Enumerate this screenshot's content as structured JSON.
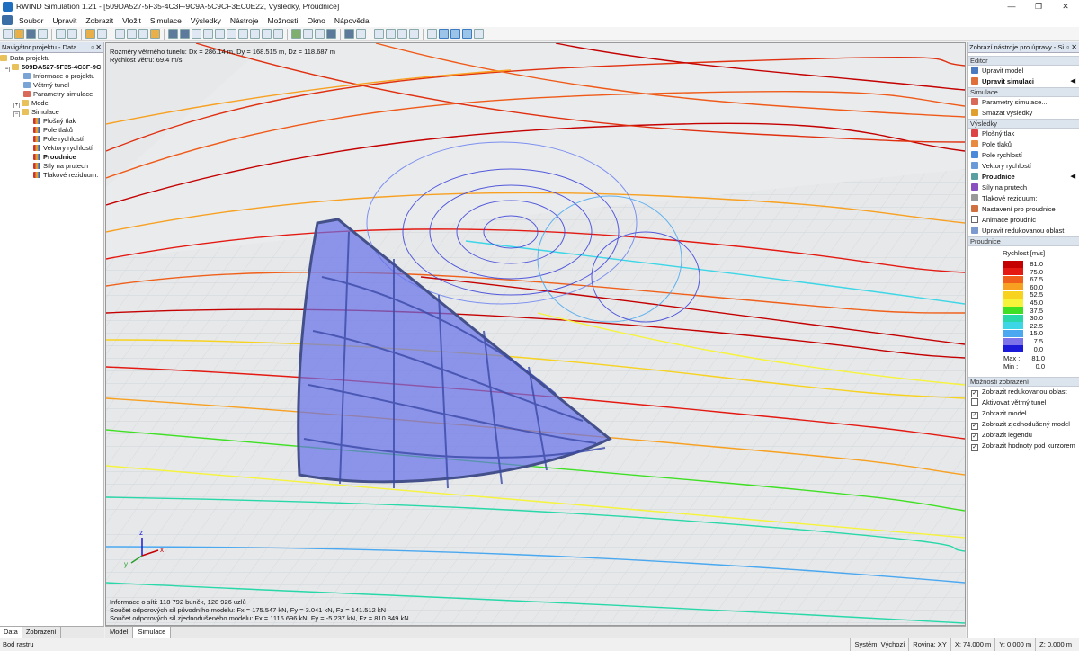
{
  "title": "RWIND Simulation 1.21 - [509DA527-5F35-4C3F-9C9A-5C9CF3EC0E22, Výsledky, Proudnice]",
  "window_buttons": [
    "—",
    "❐",
    "✕"
  ],
  "menu": [
    "Soubor",
    "Upravit",
    "Zobrazit",
    "Vložit",
    "Simulace",
    "Výsledky",
    "Nástroje",
    "Možnosti",
    "Okno",
    "Nápověda"
  ],
  "navigator": {
    "title": "Navigátor projektu - Data",
    "buttons": "▫ ✕",
    "root": "Data projektu",
    "project": "509DA527-5F35-4C3F-9C",
    "items": [
      "Informace o projektu",
      "Větrný tunel",
      "Parametry simulace",
      "Model",
      "Simulace"
    ],
    "sim_items": [
      "Plošný tlak",
      "Pole tlaků",
      "Pole rychlostí",
      "Vektory rychlostí",
      "Proudnice",
      "Síly na prutech",
      "Tlakové reziduum:"
    ],
    "tabs": [
      "Data",
      "Zobrazení"
    ]
  },
  "viewport": {
    "info_top1": "Rozměry větrného tunelu: Dx = 286.14 m, Dy = 168.515 m, Dz = 118.687 m",
    "info_top2": "Rychlost větru: 69.4 m/s",
    "info_bottom1": "Informace o síti: 118 792 buněk, 128 926 uzlů",
    "info_bottom2": "Součet odporových sil původního modelu: Fx = 175.547 kN, Fy = 3.041 kN, Fz = 141.512 kN",
    "info_bottom3": "Součet odporových sil zjednodušeného modelu: Fx = 1116.696 kN, Fy = -5.237 kN, Fz = 810.849 kN",
    "axis_labels": [
      "x",
      "y",
      "z"
    ],
    "tabs": [
      "Model",
      "Simulace"
    ]
  },
  "right": {
    "title": "Zobrazí nástroje pro úpravy - Si...",
    "buttons": "▫ ✕",
    "sections": {
      "editor": "Editor",
      "simulace": "Simulace",
      "vysledky": "Výsledky",
      "proudnice": "Proudnice",
      "moznosti": "Možnosti zobrazení"
    },
    "editor_items": [
      "Upravit model",
      "Upravit simulaci"
    ],
    "simulace_items": [
      "Parametry simulace...",
      "Smazat výsledky"
    ],
    "vysledky_items": [
      "Plošný tlak",
      "Pole tlaků",
      "Pole rychlostí",
      "Vektory rychlostí",
      "Proudnice",
      "Síly na prutech",
      "Tlakové reziduum:",
      "Nastavení pro proudnice",
      "Animace proudnic",
      "Upravit redukovanou oblast"
    ],
    "legend_title": "Rychlost [m/s]",
    "legend": [
      {
        "value": "81.0",
        "color": "#c40000"
      },
      {
        "value": "75.0",
        "color": "#e41a12"
      },
      {
        "value": "67.5",
        "color": "#f0601a"
      },
      {
        "value": "60.0",
        "color": "#f8a020"
      },
      {
        "value": "52.5",
        "color": "#f7d21e"
      },
      {
        "value": "45.0",
        "color": "#f6f43a"
      },
      {
        "value": "37.5",
        "color": "#3fe024"
      },
      {
        "value": "30.0",
        "color": "#28d8a8"
      },
      {
        "value": "22.5",
        "color": "#3cd6e6"
      },
      {
        "value": "15.0",
        "color": "#4aa8f0"
      },
      {
        "value": "7.5",
        "color": "#7c74e8"
      },
      {
        "value": "0.0",
        "color": "#1a1ad8"
      }
    ],
    "max_label": "Max :",
    "max_value": "81.0",
    "min_label": "Min :",
    "min_value": "0.0",
    "options": [
      {
        "label": "Zobrazit redukovanou oblast",
        "checked": true
      },
      {
        "label": "Aktivovat větrný tunel",
        "checked": false
      },
      {
        "label": "Zobrazit model",
        "checked": true
      },
      {
        "label": "Zobrazit zjednodušený model",
        "checked": true
      },
      {
        "label": "Zobrazit legendu",
        "checked": true
      },
      {
        "label": "Zobrazit hodnoty pod kurzorem",
        "checked": true
      }
    ],
    "check_mark": "✓"
  },
  "status": {
    "left": "Bod rastru",
    "system": "Systém: Výchozí",
    "plane": "Rovina: XY",
    "x": "X: 74.000 m",
    "y": "Y: 0.000 m",
    "z": "Z: 0.000 m"
  }
}
